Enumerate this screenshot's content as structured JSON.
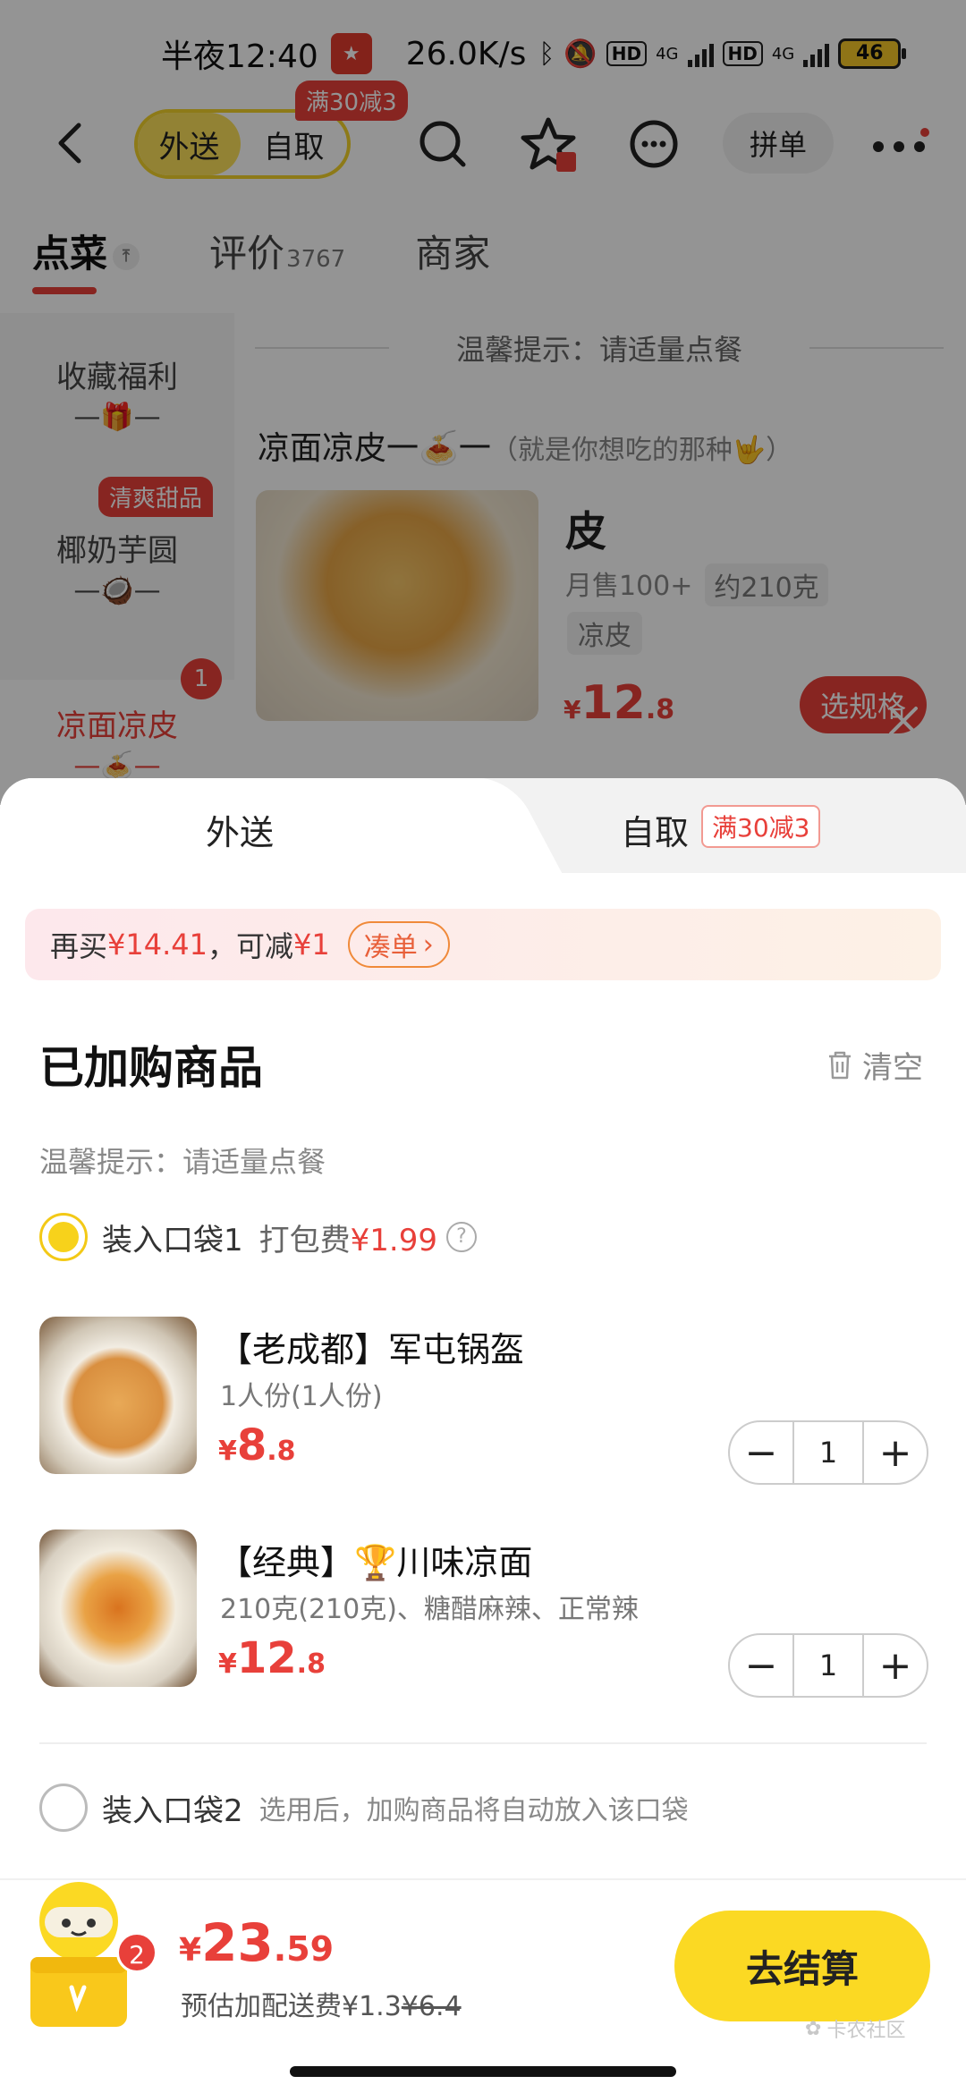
{
  "status_bar": {
    "time": "半夜12:40",
    "net_speed": "26.0K/s",
    "hd": "HD",
    "net_type": "4G",
    "battery": "46"
  },
  "top_nav": {
    "mode_delivery": "外送",
    "mode_pickup": "自取",
    "mode_promo": "满30减3",
    "group_order": "拼单"
  },
  "store_tabs": {
    "order": "点菜",
    "reviews": "评价",
    "reviews_count": "3767",
    "merchant": "商家"
  },
  "catalog": {
    "items": [
      {
        "label": "收藏福利"
      },
      {
        "label": "椰奶芋圆",
        "tag": "清爽甜品"
      },
      {
        "label": "凉面凉皮",
        "badge": "1"
      }
    ]
  },
  "menu": {
    "tip": "温馨提示：请适量点餐",
    "section_title": "凉面凉皮一🍝一",
    "section_sub": "（就是你想吃的那种🤟）",
    "dish": {
      "name": "皮",
      "monthly_sales": "月售100+",
      "weight": "约210克",
      "tag": "凉皮",
      "price_cur": "¥",
      "price_int": "12",
      "price_dec": ".8",
      "spec_button": "选规格"
    }
  },
  "sheet": {
    "tab_delivery": "外送",
    "tab_pickup": "自取",
    "pickup_promo": "满30减3",
    "coupon": {
      "prefix": "再买",
      "amount": "¥14.41",
      "middle": "，可减",
      "discount": "¥1",
      "button": "凑单"
    },
    "title": "已加购商品",
    "clear": "清空",
    "tip": "温馨提示：请适量点餐",
    "bag1": {
      "label": "装入口袋1",
      "fee_label": "打包费",
      "fee": "¥1.99"
    },
    "bag2": {
      "label": "装入口袋2",
      "note": "选用后，加购商品将自动放入该口袋"
    },
    "items": [
      {
        "name": "【老成都】军屯锅盔",
        "spec": "1人份(1人份)",
        "price_cur": "¥",
        "price_int": "8",
        "price_dec": ".8",
        "qty": "1"
      },
      {
        "name": "【经典】🏆川味凉面",
        "spec": "210克(210克)、糖醋麻辣、正常辣",
        "price_cur": "¥",
        "price_int": "12",
        "price_dec": ".8",
        "qty": "1"
      }
    ]
  },
  "checkout": {
    "cart_count": "2",
    "total_cur": "¥",
    "total_int": "23",
    "total_dec": ".59",
    "delivery_label": "预估加配送费",
    "delivery_fee": "¥1.3",
    "delivery_original": "¥6.4",
    "button": "去结算",
    "watermark": "卡农社区"
  },
  "colors": {
    "accent_red": "#e8403a",
    "brand_yellow": "#fbd923"
  },
  "icons": [
    "back-icon",
    "search-icon",
    "star-icon",
    "message-icon",
    "more-icon",
    "trash-icon",
    "chevron-right-icon",
    "minus-icon",
    "plus-icon",
    "help-icon",
    "close-icon"
  ]
}
